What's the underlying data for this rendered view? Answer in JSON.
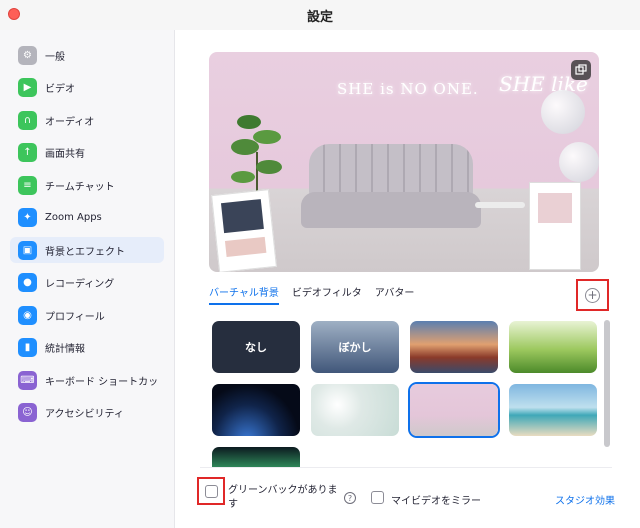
{
  "window": {
    "title": "設定"
  },
  "sidebar": {
    "items": [
      {
        "label": "一般",
        "icon": "gear-icon",
        "color": "#b4b4bc"
      },
      {
        "label": "ビデオ",
        "icon": "video-camera-icon",
        "color": "#3dc55c"
      },
      {
        "label": "オーディオ",
        "icon": "headphones-icon",
        "color": "#3dc55c"
      },
      {
        "label": "画面共有",
        "icon": "screen-share-icon",
        "color": "#3dc55c"
      },
      {
        "label": "チームチャット",
        "icon": "chat-bubble-icon",
        "color": "#3dc55c"
      },
      {
        "label": "Zoom Apps",
        "icon": "apps-icon",
        "color": "#1f8fff"
      },
      {
        "label": "背景とエフェクト",
        "icon": "person-background-icon",
        "color": "#1f8fff"
      },
      {
        "label": "レコーディング",
        "icon": "record-icon",
        "color": "#1f8fff"
      },
      {
        "label": "プロフィール",
        "icon": "profile-icon",
        "color": "#1f8fff"
      },
      {
        "label": "統計情報",
        "icon": "bar-chart-icon",
        "color": "#1f8fff"
      },
      {
        "label": "キーボード ショートカッ",
        "icon": "keyboard-icon",
        "color": "#8a63d2"
      },
      {
        "label": "アクセシビリティ",
        "icon": "accessibility-icon",
        "color": "#8a63d2"
      }
    ],
    "active_index": 6
  },
  "preview": {
    "neon_text": "SHE is NO ONE.",
    "neon_text_2": "SHE like"
  },
  "tabs": [
    {
      "label": "バーチャル背景",
      "active": true
    },
    {
      "label": "ビデオフィルタ",
      "active": false
    },
    {
      "label": "アバター",
      "active": false
    }
  ],
  "backgrounds": [
    {
      "label": "なし",
      "kind": "none"
    },
    {
      "label": "ぼかし",
      "kind": "blur"
    },
    {
      "label": "",
      "kind": "golden-gate"
    },
    {
      "label": "",
      "kind": "grass"
    },
    {
      "label": "",
      "kind": "earth"
    },
    {
      "label": "",
      "kind": "bokeh"
    },
    {
      "label": "",
      "kind": "living-room",
      "selected": true
    },
    {
      "label": "",
      "kind": "beach"
    },
    {
      "label": "",
      "kind": "aurora"
    }
  ],
  "footer": {
    "green_screen_label": "グリーンバックがあります",
    "help_glyph": "?",
    "mirror_label": "マイビデオをミラー",
    "studio_label": "スタジオ効果"
  },
  "colors": {
    "accent": "#0e71eb",
    "highlight_box": "#e02828"
  }
}
